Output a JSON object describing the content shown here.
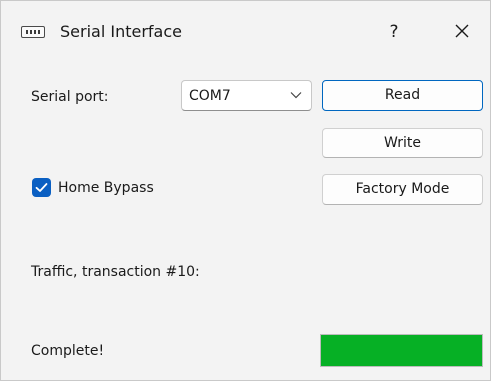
{
  "window": {
    "title": "Serial Interface",
    "help_label": "?"
  },
  "serial": {
    "port_label": "Serial port:",
    "port_value": "COM7"
  },
  "buttons": {
    "read": "Read",
    "write": "Write",
    "factory_mode": "Factory Mode"
  },
  "options": {
    "home_bypass_label": "Home Bypass",
    "home_bypass_checked": true
  },
  "traffic": {
    "label": "Traffic, transaction #10:"
  },
  "status": {
    "text": "Complete!",
    "progress_fraction": 1.0
  },
  "colors": {
    "checkbox_accent": "#0a5fc2",
    "default_button_border": "#0067c0",
    "progress_fill": "#06b025",
    "window_background": "#f3f3f3"
  },
  "icons": {
    "title": "serial-port-icon",
    "close": "close-icon",
    "dropdown": "chevron-down-icon",
    "check": "checkmark-icon"
  }
}
